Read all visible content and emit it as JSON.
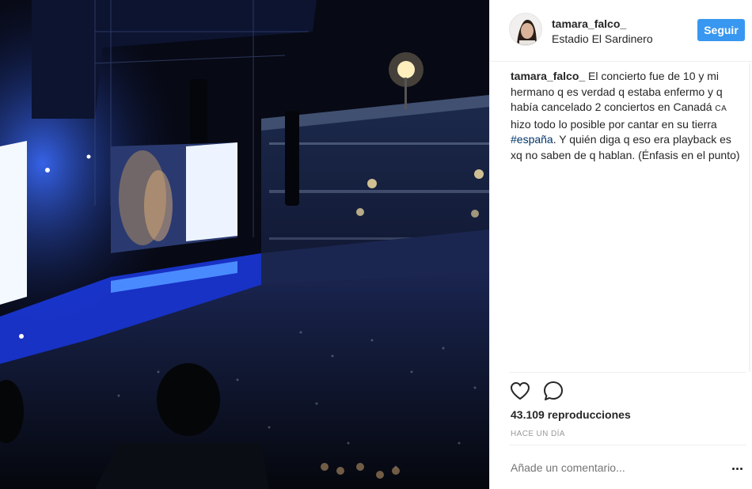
{
  "post": {
    "username": "tamara_falco_",
    "location": "Estadio El Sardinero",
    "follow_label": "Seguir",
    "caption": {
      "user": "tamara_falco_",
      "text_1": " El concierto fue de 10 y mi hermano q es verdad q estaba enfermo y q había cancelado 2 conciertos en Canadá ",
      "ca": "CA",
      "text_2": " hizo todo lo posible por cantar en su tierra ",
      "hashtag": "#españa",
      "text_3": ". Y quién diga q eso era playback es xq no saben de q hablan. (Énfasis en el punto)"
    },
    "views": "43.109 reproducciones",
    "time": "Hace un día",
    "comment_placeholder": "Añade un comentario..."
  },
  "icons": {
    "like": "heart-icon",
    "comment": "comment-bubble-icon",
    "more": "more-options-icon"
  },
  "colors": {
    "follow_button": "#3897f0",
    "hashtag": "#003569",
    "secondary_text": "#999999"
  }
}
